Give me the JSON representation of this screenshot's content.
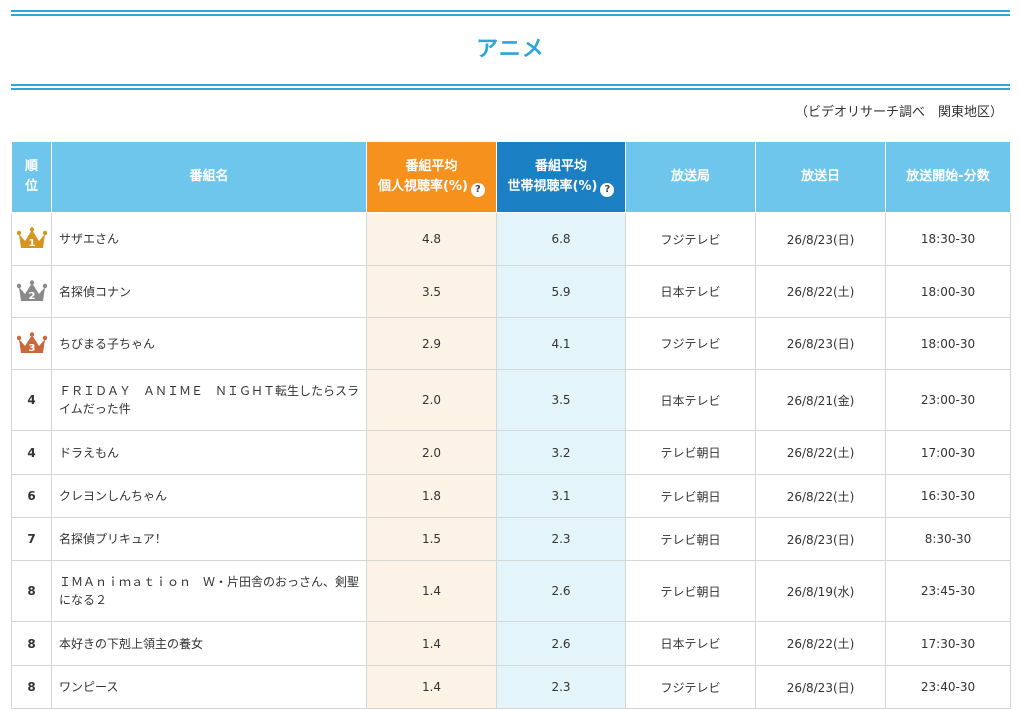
{
  "page": {
    "title": "アニメ",
    "source_note": "（ビデオリサーチ調べ　関東地区）"
  },
  "table": {
    "headers": {
      "rank": "順\n位",
      "program": "番組名",
      "personal_line1": "番組平均",
      "personal_line2": "個人視聴率(%)",
      "household_line1": "番組平均",
      "household_line2": "世帯視聴率(%)",
      "station": "放送局",
      "date": "放送日",
      "start": "放送開始-分数"
    },
    "help_icon_glyph": "?",
    "rows": [
      {
        "rank": "1",
        "crown": "gold",
        "program": "サザエさん",
        "personal": "4.8",
        "household": "6.8",
        "station": "フジテレビ",
        "date": "26/8/23(日)",
        "start": "18:30-30"
      },
      {
        "rank": "2",
        "crown": "silver",
        "program": "名探偵コナン",
        "personal": "3.5",
        "household": "5.9",
        "station": "日本テレビ",
        "date": "26/8/22(土)",
        "start": "18:00-30"
      },
      {
        "rank": "3",
        "crown": "bronze",
        "program": "ちびまる子ちゃん",
        "personal": "2.9",
        "household": "4.1",
        "station": "フジテレビ",
        "date": "26/8/23(日)",
        "start": "18:00-30"
      },
      {
        "rank": "4",
        "crown": "",
        "program": "ＦＲＩＤＡＹ　ＡＮＩＭＥ　ＮＩＧＨＴ転生したらスライムだった件",
        "personal": "2.0",
        "household": "3.5",
        "station": "日本テレビ",
        "date": "26/8/21(金)",
        "start": "23:00-30"
      },
      {
        "rank": "4",
        "crown": "",
        "program": "ドラえもん",
        "personal": "2.0",
        "household": "3.2",
        "station": "テレビ朝日",
        "date": "26/8/22(土)",
        "start": "17:00-30"
      },
      {
        "rank": "6",
        "crown": "",
        "program": "クレヨンしんちゃん",
        "personal": "1.8",
        "household": "3.1",
        "station": "テレビ朝日",
        "date": "26/8/22(土)",
        "start": "16:30-30"
      },
      {
        "rank": "7",
        "crown": "",
        "program": "名探偵プリキュア！",
        "personal": "1.5",
        "household": "2.3",
        "station": "テレビ朝日",
        "date": "26/8/23(日)",
        "start": "8:30-30"
      },
      {
        "rank": "8",
        "crown": "",
        "program": "ＩＭＡｎｉｍａｔｉｏｎ　Ｗ・片田舎のおっさん、剣聖になる２",
        "personal": "1.4",
        "household": "2.6",
        "station": "テレビ朝日",
        "date": "26/8/19(水)",
        "start": "23:45-30"
      },
      {
        "rank": "8",
        "crown": "",
        "program": "本好きの下剋上領主の養女",
        "personal": "1.4",
        "household": "2.6",
        "station": "日本テレビ",
        "date": "26/8/22(土)",
        "start": "17:30-30"
      },
      {
        "rank": "8",
        "crown": "",
        "program": "ワンピース",
        "personal": "1.4",
        "household": "2.3",
        "station": "フジテレビ",
        "date": "26/8/23(日)",
        "start": "23:40-30"
      }
    ]
  },
  "colors": {
    "accent": "#2fa6d8",
    "header_default": "#6ec6ec",
    "header_personal": "#f7911e",
    "header_household": "#1b80c3",
    "crown_gold": "#d6951f",
    "crown_silver": "#8a8a8a",
    "crown_bronze": "#c9683d"
  }
}
